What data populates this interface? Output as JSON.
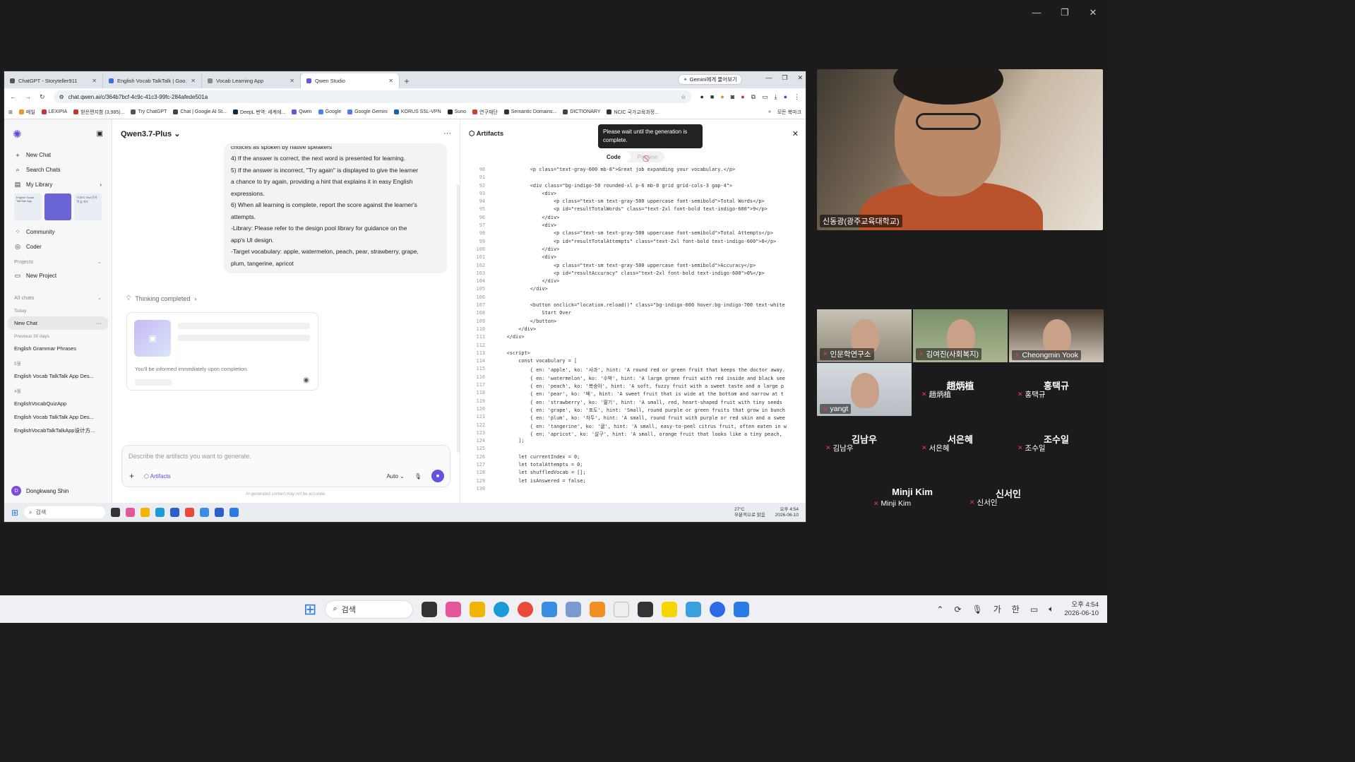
{
  "browser": {
    "tabs": [
      {
        "title": "ChatGPT - Storyteller911",
        "color": "#555"
      },
      {
        "title": "English Vocab TalkTalk | Goo…",
        "color": "#3a6fd8"
      },
      {
        "title": "Vocab Learning App",
        "color": "#888"
      },
      {
        "title": "Qwen Studio",
        "color": "#6152e0"
      }
    ],
    "gemini_label": "Gemini에게 물어보기",
    "url": "chat.qwen.ai/c/364b7bcf-4c9c-41c3-99fc-284afede501a",
    "bookmarks": [
      "메일",
      "LEXIPIA",
      "받은편지함 (3,985)...",
      "Try ChatGPT",
      "Chat | Google AI St...",
      "DeepL 번역: 세계에...",
      "Qwen",
      "Google",
      "Google Gemini",
      "KORUS SSL-VPN",
      "Suno",
      "연구재단",
      "Semantic Domains...",
      "DICTIONARY",
      "NCIC 국가교육과정..."
    ],
    "all_bookmarks": "모든 북마크"
  },
  "sidebar": {
    "new_chat": "New Chat",
    "search_chats": "Search Chats",
    "my_library": "My Library",
    "thumb1": "English Vocab TalkTalk App",
    "thumb3": "TOEIC Test 단어 학 습 카드",
    "community": "Community",
    "coder": "Coder",
    "projects": "Projects",
    "new_project": "New Project",
    "all_chats": "All chats",
    "today": "Today",
    "selected_chat": "New Chat",
    "prev30": "Previous 30 days",
    "chat_grammar": "English Grammar Phrases",
    "may": "5월",
    "chat_may": "English Vocab TalkTalk App Des...",
    "april": "4월",
    "chat_apr1": "EnglishVocabQuizApp",
    "chat_apr2": "English Vocab TalkTalk App Des...",
    "chat_apr3": "EnglishVocabTalkTalkApp设计方...",
    "user_initial": "D",
    "user_name": "Dongkwang Shin"
  },
  "chat": {
    "model": "Qwen3.7-Plus",
    "message_lines": [
      "choices as spoken by native speakers",
      "4) If the answer is correct, the next word is presented for learning.",
      "5) If the answer is incorrect, \"Try again\" is displayed to give the learner",
      "a chance to try again, providing a hint that explains it in easy English",
      "expressions.",
      "6) When all learning is complete, report the score against the learner's",
      "attempts.",
      "-Library: Please refer to the design pool library for guidance on the",
      "app's UI design.",
      "-Target vocabulary: apple, watermelon, peach, pear, strawberry, grape,",
      "plum, tangerine, apricot"
    ],
    "thinking": "Thinking completed",
    "gen_note": "You'll be informed immediately upon completion.",
    "input_placeholder": "Describe the artifacts you want to generate.",
    "artifacts_chip": "Artifacts",
    "mode": "Auto",
    "disclaimer": "AI-generated content may not be accurate."
  },
  "artifacts": {
    "title": "Artifacts",
    "tab_code": "Code",
    "tab_preview": "Preview",
    "tooltip": "Please wait until the generation is complete.",
    "code_lines": [
      {
        "n": "90",
        "t": "            <p class=\"text-gray-600 mb-8\">Great job expanding your vocabulary.</p>"
      },
      {
        "n": "91",
        "t": ""
      },
      {
        "n": "92",
        "t": "            <div class=\"bg-indigo-50 rounded-xl p-6 mb-8 grid grid-cols-3 gap-4\">"
      },
      {
        "n": "93",
        "t": "                <div>"
      },
      {
        "n": "94",
        "t": "                    <p class=\"text-sm text-gray-500 uppercase font-semibold\">Total Words</p>"
      },
      {
        "n": "95",
        "t": "                    <p id=\"resultTotalWords\" class=\"text-2xl font-bold text-indigo-600\">9</p>"
      },
      {
        "n": "96",
        "t": "                </div>"
      },
      {
        "n": "97",
        "t": "                <div>"
      },
      {
        "n": "98",
        "t": "                    <p class=\"text-sm text-gray-500 uppercase font-semibold\">Total Attempts</p>"
      },
      {
        "n": "99",
        "t": "                    <p id=\"resultTotalAttempts\" class=\"text-2xl font-bold text-indigo-600\">0</p>"
      },
      {
        "n": "100",
        "t": "                </div>"
      },
      {
        "n": "101",
        "t": "                <div>"
      },
      {
        "n": "102",
        "t": "                    <p class=\"text-sm text-gray-500 uppercase font-semibold\">Accuracy</p>"
      },
      {
        "n": "103",
        "t": "                    <p id=\"resultAccuracy\" class=\"text-2xl font-bold text-indigo-600\">0%</p>"
      },
      {
        "n": "104",
        "t": "                </div>"
      },
      {
        "n": "105",
        "t": "            </div>"
      },
      {
        "n": "106",
        "t": ""
      },
      {
        "n": "107",
        "t": "            <button onclick=\"location.reload()\" class=\"bg-indigo-600 hover:bg-indigo-700 text-white"
      },
      {
        "n": "108",
        "t": "                Start Over"
      },
      {
        "n": "109",
        "t": "            </button>"
      },
      {
        "n": "110",
        "t": "        </div>"
      },
      {
        "n": "111",
        "t": "    </div>"
      },
      {
        "n": "112",
        "t": ""
      },
      {
        "n": "113",
        "t": "    <script>"
      },
      {
        "n": "114",
        "t": "        const vocabulary = ["
      },
      {
        "n": "115",
        "t": "            { en: 'apple', ko: '사과', hint: 'A round red or green fruit that keeps the doctor away."
      },
      {
        "n": "116",
        "t": "            { en: 'watermelon', ko: '수박', hint: 'A large green fruit with red inside and black see"
      },
      {
        "n": "117",
        "t": "            { en: 'peach', ko: '복숭아', hint: 'A soft, fuzzy fruit with a sweet taste and a large p"
      },
      {
        "n": "118",
        "t": "            { en: 'pear', ko: '배', hint: 'A sweet fruit that is wide at the bottom and narrow at t"
      },
      {
        "n": "119",
        "t": "            { en: 'strawberry', ko: '딸기', hint: 'A small, red, heart-shaped fruit with tiny seeds"
      },
      {
        "n": "120",
        "t": "            { en: 'grape', ko: '포도', hint: 'Small, round purple or green fruits that grow in bunch"
      },
      {
        "n": "121",
        "t": "            { en: 'plum', ko: '자두', hint: 'A small, round fruit with purple or red skin and a swee"
      },
      {
        "n": "122",
        "t": "            { en: 'tangerine', ko: '귤', hint: 'A small, easy-to-peel citrus fruit, often eaten in w"
      },
      {
        "n": "123",
        "t": "            { en: 'apricot', ko: '살구', hint: 'A small, orange fruit that looks like a tiny peach,"
      },
      {
        "n": "124",
        "t": "        ];"
      },
      {
        "n": "125",
        "t": ""
      },
      {
        "n": "126",
        "t": "        let currentIndex = 0;"
      },
      {
        "n": "127",
        "t": "        let totalAttempts = 0;"
      },
      {
        "n": "128",
        "t": "        let shuffledVocab = [];"
      },
      {
        "n": "129",
        "t": "        let isAnswered = false;"
      },
      {
        "n": "130",
        "t": ""
      }
    ]
  },
  "inner_taskbar": {
    "search": "검색",
    "weather": "27°C",
    "weather_desc": "부분적으로 맑음",
    "time": "오후 4:54",
    "date": "2026-06-10"
  },
  "zoom": {
    "speaker": "신동광(광주교육대학교)",
    "participants": [
      {
        "name": "인문학연구소",
        "video": true
      },
      {
        "name": "김여진(사회복지)",
        "video": true
      },
      {
        "name": "Cheongmin Yook",
        "video": true
      },
      {
        "name": "yangt",
        "video": true
      },
      {
        "name": "趙炳植",
        "video": false
      },
      {
        "name": "홍택규",
        "video": false
      },
      {
        "name": "김남우",
        "video": false
      },
      {
        "name": "서은혜",
        "video": false
      },
      {
        "name": "조수일",
        "video": false
      },
      {
        "name": "Minji Kim",
        "video": false
      },
      {
        "name": "신서인",
        "video": false
      }
    ]
  },
  "taskbar": {
    "search": "검색",
    "ime1": "가",
    "ime2": "한",
    "time": "오후 4:54",
    "date": "2026-06-10"
  }
}
